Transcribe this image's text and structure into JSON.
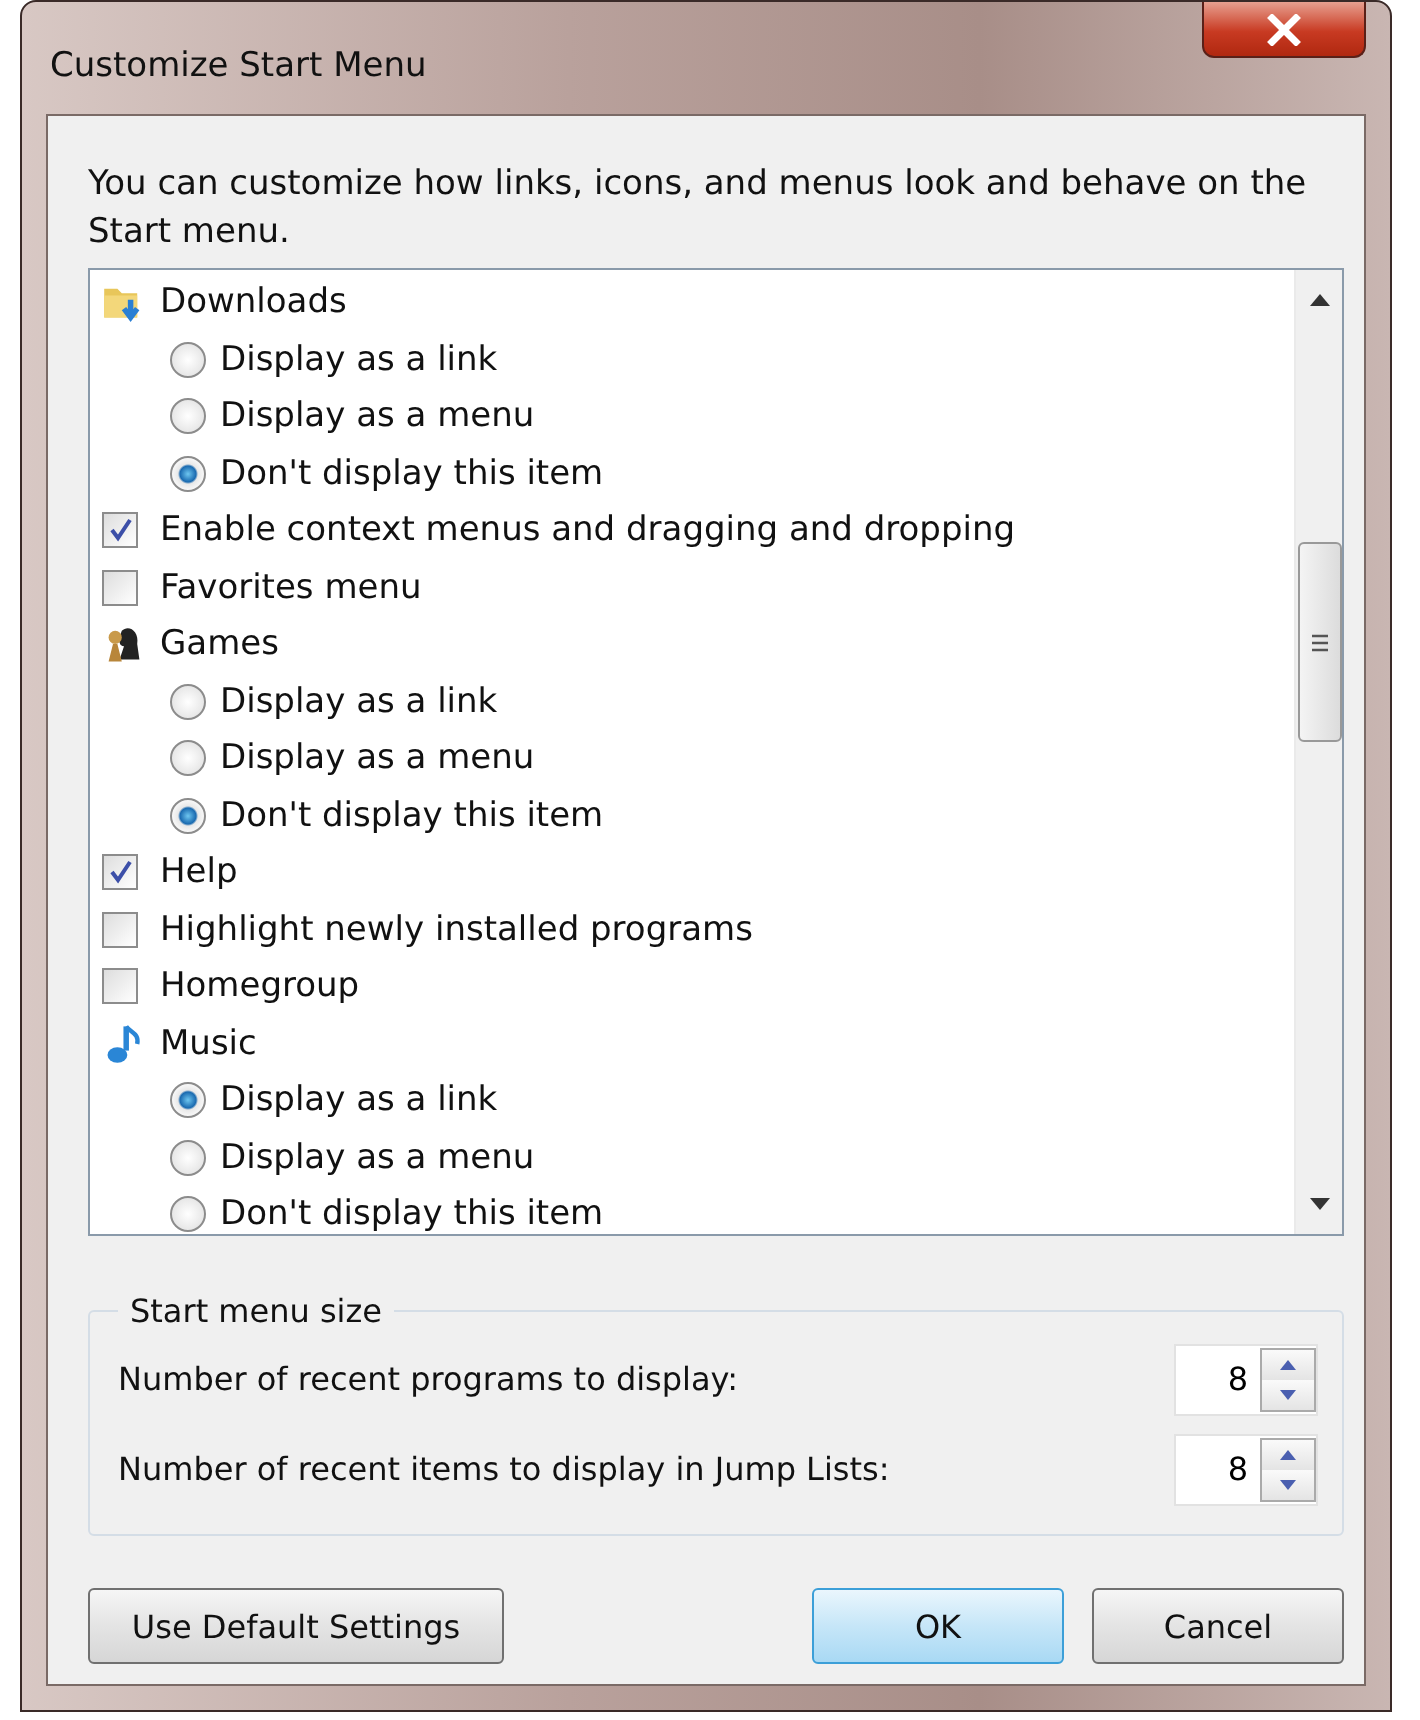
{
  "window": {
    "title": "Customize Start Menu"
  },
  "description": "You can customize how links, icons, and menus look and behave on the Start menu.",
  "options": [
    {
      "kind": "header",
      "label": "Downloads",
      "children": [
        {
          "label": "Display as a link",
          "selected": false
        },
        {
          "label": "Display as a menu",
          "selected": false
        },
        {
          "label": "Don't display this item",
          "selected": true
        }
      ]
    },
    {
      "kind": "checkbox",
      "label": "Enable context menus and dragging and dropping",
      "checked": true
    },
    {
      "kind": "checkbox",
      "label": "Favorites menu",
      "checked": false
    },
    {
      "kind": "header",
      "label": "Games",
      "children": [
        {
          "label": "Display as a link",
          "selected": false
        },
        {
          "label": "Display as a menu",
          "selected": false
        },
        {
          "label": "Don't display this item",
          "selected": true
        }
      ]
    },
    {
      "kind": "checkbox",
      "label": "Help",
      "checked": true
    },
    {
      "kind": "checkbox",
      "label": "Highlight newly installed programs",
      "checked": false
    },
    {
      "kind": "checkbox",
      "label": "Homegroup",
      "checked": false
    },
    {
      "kind": "header",
      "label": "Music",
      "children": [
        {
          "label": "Display as a link",
          "selected": true
        },
        {
          "label": "Display as a menu",
          "selected": false
        },
        {
          "label": "Don't display this item",
          "selected": false
        }
      ]
    }
  ],
  "size_group": {
    "title": "Start menu size",
    "spinners": [
      {
        "label": "Number of recent programs to display:",
        "value": "8"
      },
      {
        "label": "Number of recent items to display in Jump Lists:",
        "value": "8"
      }
    ]
  },
  "buttons": {
    "defaults": "Use Default Settings",
    "ok": "OK",
    "cancel": "Cancel"
  }
}
